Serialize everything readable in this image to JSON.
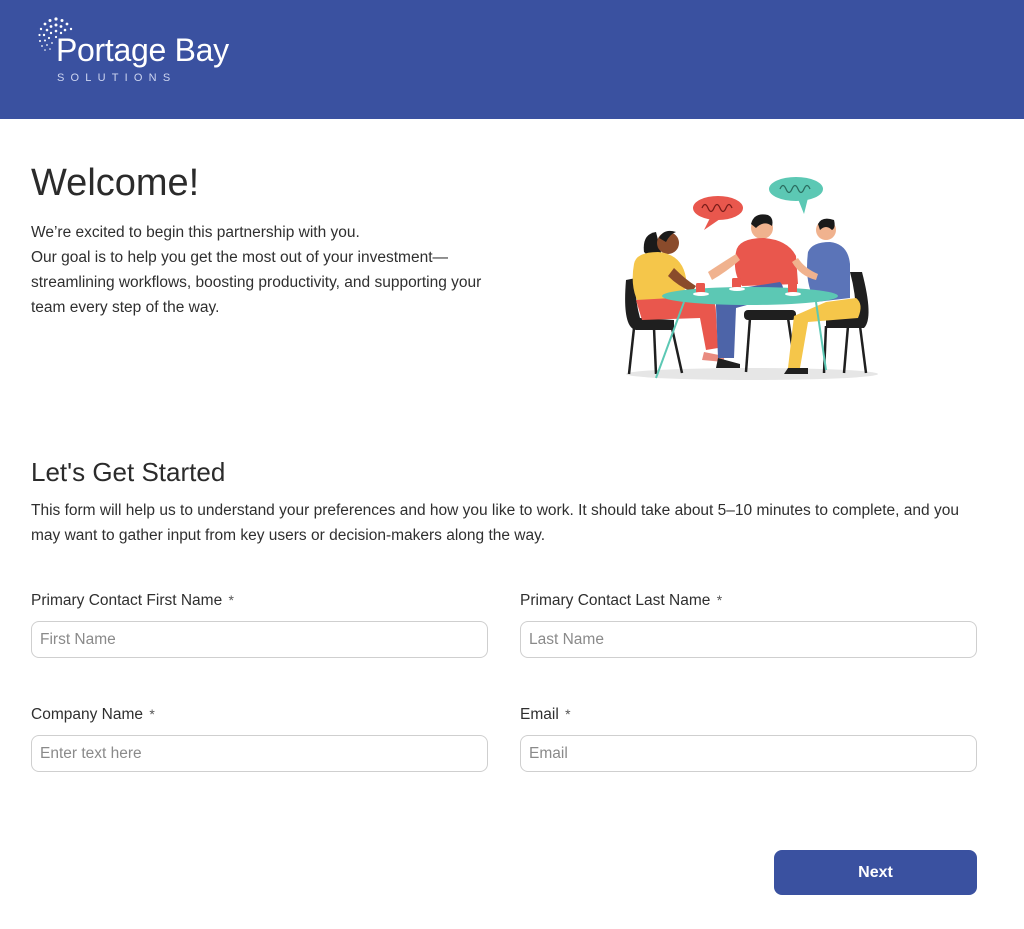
{
  "header": {
    "brand_name": "Portage Bay",
    "brand_sub": "SOLUTIONS",
    "background_color": "#3a51a0"
  },
  "welcome": {
    "title": "Welcome!",
    "lines": [
      "We’re excited to begin this partnership with you.",
      "Our goal is to help you get the most out of your investment—streamlining workflows, boosting productivity, and supporting your team every step of the way."
    ]
  },
  "illustration": {
    "icon": "team-meeting-illustration"
  },
  "start": {
    "title": "Let's Get Started",
    "description": "This form will help us to understand your preferences and how you like to work. It should take about 5–10 minutes to complete, and you may want to gather input from key users or decision-makers along the way."
  },
  "form": {
    "required_marker": "*",
    "first_name": {
      "label": "Primary Contact First Name",
      "placeholder": "First Name",
      "value": ""
    },
    "last_name": {
      "label": "Primary Contact Last Name",
      "placeholder": "Last Name",
      "value": ""
    },
    "company": {
      "label": "Company Name",
      "placeholder": "Enter text here",
      "value": ""
    },
    "email": {
      "label": "Email",
      "placeholder": "Email",
      "value": ""
    }
  },
  "actions": {
    "next_label": "Next",
    "accent_color": "#3a51a0"
  }
}
